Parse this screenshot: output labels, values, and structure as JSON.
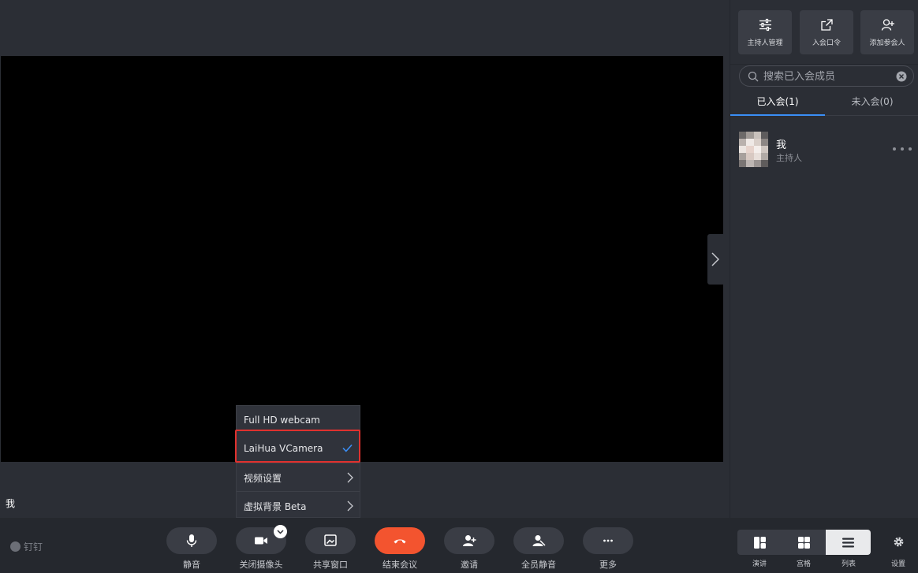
{
  "main": {
    "self_label": "我"
  },
  "camera_menu": {
    "items": [
      {
        "label": "Full HD webcam",
        "selected": false,
        "submenu": false
      },
      {
        "label": "LaiHua VCamera",
        "selected": true,
        "submenu": false
      },
      {
        "label": "视频设置",
        "selected": false,
        "submenu": true
      },
      {
        "label": "虚拟背景 Beta",
        "selected": false,
        "submenu": true
      }
    ]
  },
  "toolbar": {
    "brand": "钉钉",
    "buttons": {
      "mute": "静音",
      "camera": "关闭摄像头",
      "share": "共享窗口",
      "end": "结束会议",
      "invite": "邀请",
      "mute_all": "全员静音",
      "more": "更多"
    },
    "views": {
      "speaker": "演讲",
      "grid": "宫格",
      "list": "列表"
    },
    "settings": "设置"
  },
  "panel": {
    "top_buttons": {
      "host_manage": "主持人管理",
      "meeting_code": "入会口令",
      "add_participant": "添加参会人"
    },
    "search": {
      "placeholder": "搜索已入会成员",
      "value": ""
    },
    "tabs": {
      "joined": "已入会(1)",
      "not_joined": "未入会(0)"
    },
    "members": [
      {
        "name": "我",
        "role": "主持人"
      }
    ]
  },
  "colors": {
    "accent": "#3a8ef6",
    "end_call": "#f3542f",
    "highlight": "#e0312e"
  }
}
